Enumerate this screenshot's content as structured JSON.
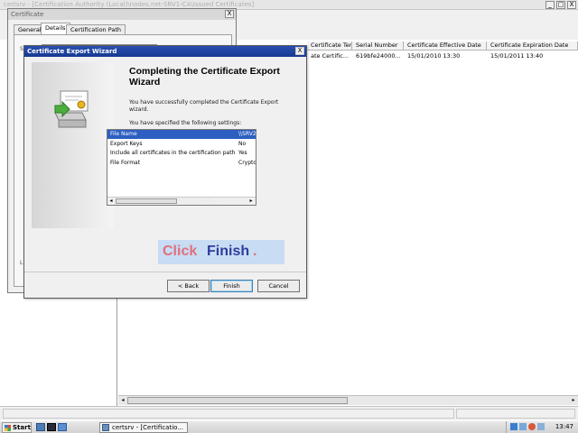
{
  "mmc": {
    "title": "certsrv - [Certification Authority (Local)\\nodes.net-SRV1-CA\\Issued Certificates]",
    "window_controls": {
      "minimize": "_",
      "maximize": "□",
      "close": "X"
    },
    "columns": [
      {
        "label": "Certificate Template"
      },
      {
        "label": "Serial Number"
      },
      {
        "label": "Certificate Effective Date"
      },
      {
        "label": "Certificate Expiration Date"
      }
    ],
    "row": [
      "ate Certific...",
      "619bfe24000...",
      "15/01/2010 13:30",
      "15/01/2011 13:40"
    ]
  },
  "cert_dialog": {
    "title": "Certificate",
    "close": "X",
    "tabs": [
      {
        "label": "General"
      },
      {
        "label": "Details"
      },
      {
        "label": "Certification Path"
      }
    ],
    "active_tab": 1,
    "label_s": "S",
    "label_l": "L"
  },
  "wizard": {
    "title": "Certificate Export Wizard",
    "close": "X",
    "heading": "Completing the Certificate Export Wizard",
    "intro": "You have successfully completed the Certificate Export wizard.",
    "specified": "You have specified the following settings:",
    "settings": [
      {
        "key": "File Name",
        "value": "\\\\SRV2"
      },
      {
        "key": "Export Keys",
        "value": "No"
      },
      {
        "key": "Include all certificates in the certification path",
        "value": "Yes"
      },
      {
        "key": "File Format",
        "value": "Crypto"
      }
    ],
    "selected_setting": 0,
    "buttons": {
      "back": "< Back",
      "finish": "Finish",
      "cancel": "Cancel"
    }
  },
  "callout": {
    "word1": "Click",
    "word2": "Finish",
    "word3": "."
  },
  "taskbar": {
    "start_label": "Start",
    "task_label": "certsrv - [Certificatio...",
    "clock": "13:47"
  },
  "colors": {
    "wizard_title": "#153a92",
    "selection": "#2c5fc1",
    "callout_bg": "#c8dcf4",
    "callout_red": "#e0707c",
    "callout_blue": "#2e3e9c"
  }
}
